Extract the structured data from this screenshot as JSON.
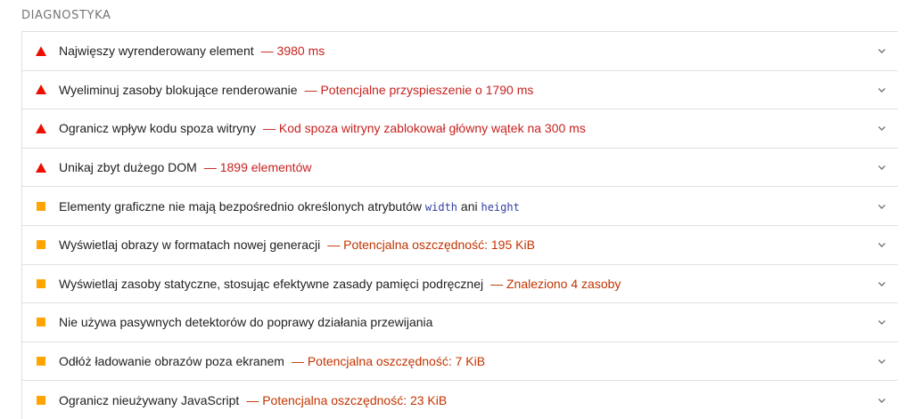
{
  "section": {
    "title": "DIAGNOSTYKA"
  },
  "audits": [
    {
      "title": "Najwięszy wyrenderowany element",
      "detail": "— 3980 ms",
      "severity": "fail"
    },
    {
      "title": "Wyeliminuj zasoby blokujące renderowanie",
      "detail": "— Potencjalne przyspieszenie o 1790 ms",
      "severity": "fail"
    },
    {
      "title": "Ogranicz wpływ kodu spoza witryny",
      "detail": "— Kod spoza witryny zablokował główny wątek na 300 ms",
      "severity": "fail"
    },
    {
      "title": "Unikaj zbyt dużego DOM",
      "detail": "— 1899 elementów",
      "severity": "fail"
    },
    {
      "title_pre": "Elementy graficzne nie mają bezpośrednio określonych atrybutów",
      "code1": "width",
      "title_mid": "ani",
      "code2": "height",
      "severity": "average"
    },
    {
      "title": "Wyświetlaj obrazy w formatach nowej generacji",
      "detail": "— Potencjalna oszczędność: 195 KiB",
      "severity": "average"
    },
    {
      "title": "Wyświetlaj zasoby statyczne, stosując efektywne zasady pamięci podręcznej",
      "detail": "— Znaleziono 4 zasoby",
      "severity": "average"
    },
    {
      "title": "Nie używa pasywnych detektorów do poprawy działania przewijania",
      "severity": "average"
    },
    {
      "title": "Odłóż ładowanie obrazów poza ekranem",
      "detail": "— Potencjalna oszczędność: 7 KiB",
      "severity": "average"
    },
    {
      "title": "Ogranicz nieużywany JavaScript",
      "detail": "— Potencjalna oszczędność: 23 KiB",
      "severity": "average"
    }
  ],
  "colors": {
    "fail": "#eb0f00",
    "average": "#ffa400",
    "fail_text": "#c7221f",
    "average_text": "#c33300"
  },
  "icons": {
    "fail": "warning-triangle-icon",
    "average": "average-square-icon",
    "expand": "chevron-down-icon"
  }
}
